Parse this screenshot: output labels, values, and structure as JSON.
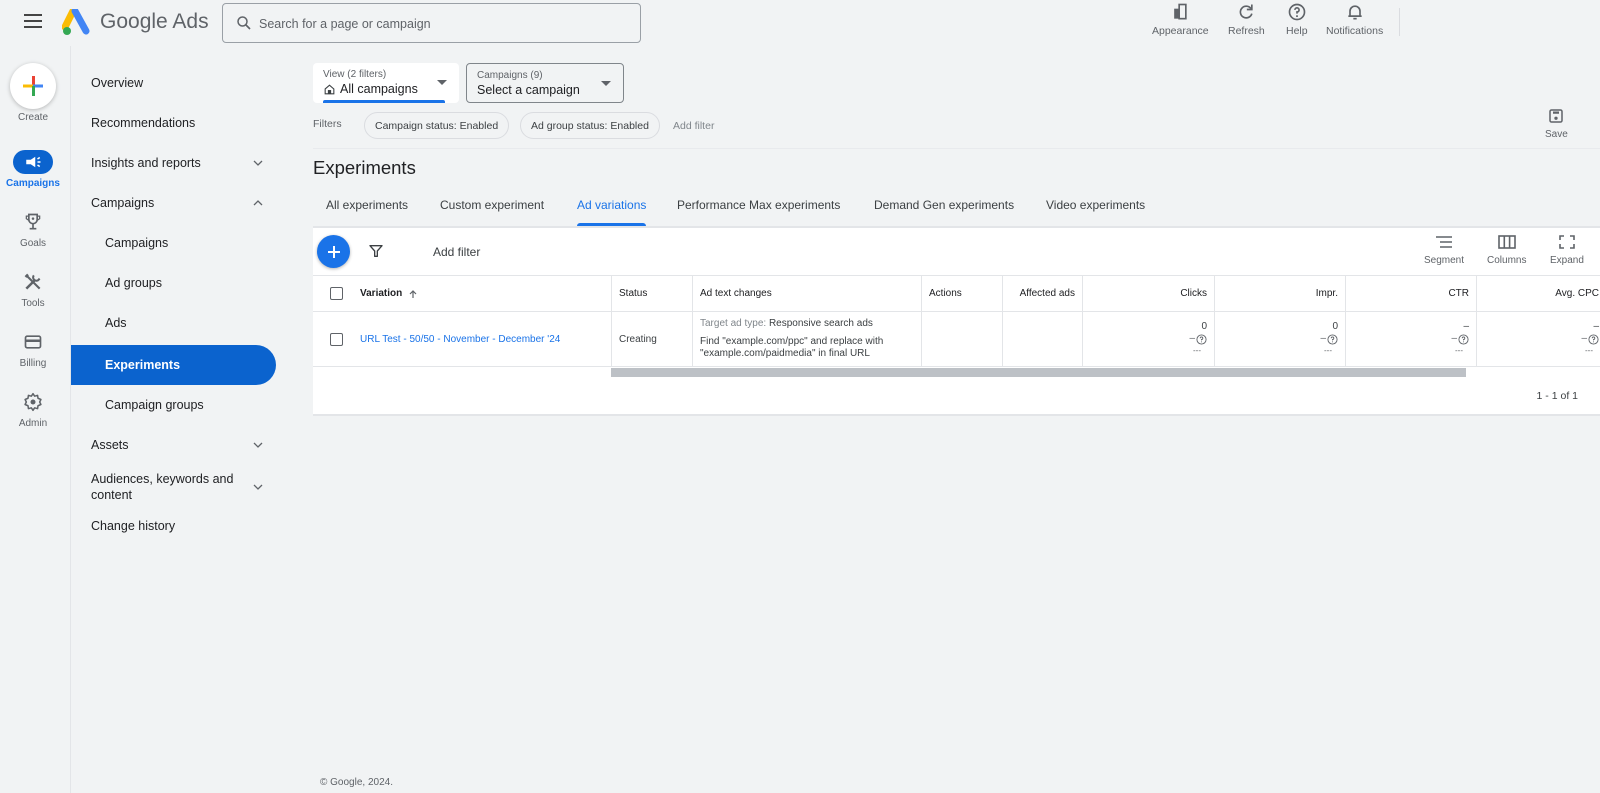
{
  "app": {
    "title": "Google Ads",
    "menu_icon": "hamburger-menu-icon",
    "search": {
      "placeholder": "Search for a page or campaign",
      "value": ""
    },
    "top_actions": [
      {
        "label": "Appearance",
        "icon": "appearance-icon"
      },
      {
        "label": "Refresh",
        "icon": "refresh-icon"
      },
      {
        "label": "Help",
        "icon": "help-icon"
      },
      {
        "label": "Notifications",
        "icon": "bell-icon"
      }
    ]
  },
  "rail": {
    "create_label": "Create",
    "items": [
      {
        "label": "Campaigns",
        "icon": "megaphone-icon",
        "active": true
      },
      {
        "label": "Goals",
        "icon": "trophy-icon"
      },
      {
        "label": "Tools",
        "icon": "tools-icon"
      },
      {
        "label": "Billing",
        "icon": "credit-card-icon"
      },
      {
        "label": "Admin",
        "icon": "gear-icon"
      }
    ]
  },
  "nav": {
    "items": [
      {
        "label": "Overview"
      },
      {
        "label": "Recommendations"
      },
      {
        "label": "Insights and reports",
        "chevron": "down"
      },
      {
        "label": "Campaigns",
        "chevron": "up"
      },
      {
        "label": "Campaigns",
        "sub": true
      },
      {
        "label": "Ad groups",
        "sub": true
      },
      {
        "label": "Ads",
        "sub": true
      },
      {
        "label": "Experiments",
        "sub": true,
        "active": true
      },
      {
        "label": "Campaign groups",
        "sub": true
      },
      {
        "label": "Assets",
        "chevron": "down"
      },
      {
        "label": "Audiences, keywords and content",
        "chevron": "down"
      },
      {
        "label": "Change history"
      }
    ]
  },
  "view_selector": {
    "label": "View (2 filters)",
    "value": "All campaigns"
  },
  "campaign_selector": {
    "label": "Campaigns (9)",
    "value": "Select a campaign"
  },
  "filters": {
    "label": "Filters",
    "chips": [
      "Campaign status: Enabled",
      "Ad group status: Enabled"
    ],
    "add_filter": "Add filter",
    "save_label": "Save"
  },
  "page": {
    "title": "Experiments",
    "tabs": [
      {
        "label": "All experiments"
      },
      {
        "label": "Custom experiment"
      },
      {
        "label": "Ad variations",
        "active": true
      },
      {
        "label": "Performance Max experiments"
      },
      {
        "label": "Demand Gen experiments"
      },
      {
        "label": "Video experiments"
      }
    ]
  },
  "table": {
    "add_filter": "Add filter",
    "tools": [
      {
        "label": "Segment",
        "icon": "segment-icon"
      },
      {
        "label": "Columns",
        "icon": "columns-icon"
      },
      {
        "label": "Expand",
        "icon": "expand-icon"
      }
    ],
    "columns": [
      "Variation",
      "Status",
      "Ad text changes",
      "Actions",
      "Affected ads",
      "Clicks",
      "Impr.",
      "CTR",
      "Avg. CPC"
    ],
    "sort": {
      "column": "Variation",
      "direction": "ascending"
    },
    "rows": [
      {
        "variation": "URL Test - 50/50 - November - December '24",
        "status": "Creating",
        "ad_text_target_label": "Target ad type:",
        "ad_text_target_value": "Responsive search ads",
        "ad_text_change": "Find \"example.com/ppc\" and replace with \"example.com/paidmedia\" in final URL",
        "actions": "",
        "affected_ads": "",
        "clicks": "0",
        "impr": "0",
        "ctr": "–",
        "avg_cpc": "–",
        "comparison": "–",
        "comparison_sub": "---"
      }
    ],
    "pagination": "1 - 1 of 1"
  },
  "footer": {
    "copyright": "© Google, 2024."
  }
}
